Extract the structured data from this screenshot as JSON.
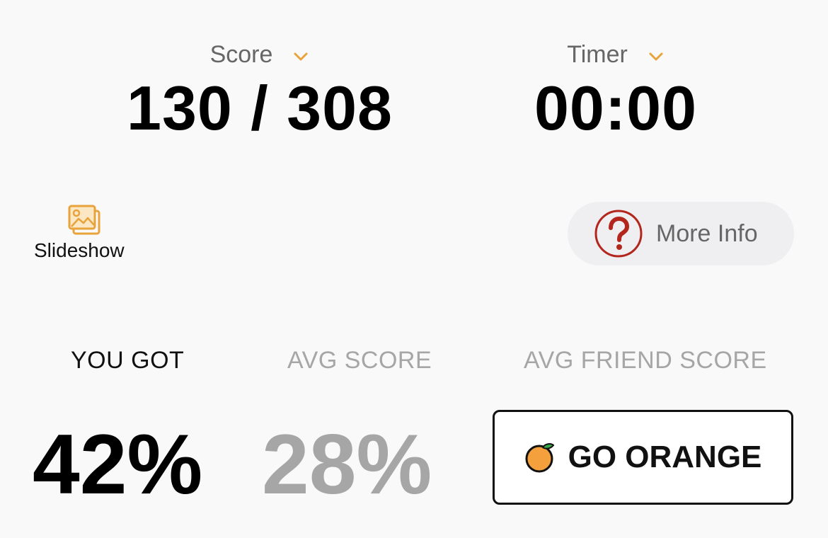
{
  "score": {
    "label": "Score",
    "value": "130 / 308"
  },
  "timer": {
    "label": "Timer",
    "value": "00:00"
  },
  "slideshow": {
    "label": "Slideshow"
  },
  "more_info": {
    "label": "More Info"
  },
  "results": {
    "you_got_label": "YOU GOT",
    "you_got_value": "42%",
    "avg_score_label": "AVG SCORE",
    "avg_score_value": "28%",
    "avg_friend_label": "AVG FRIEND SCORE",
    "go_orange_label": "GO ORANGE"
  },
  "colors": {
    "accent": "#e8a33a",
    "help_red": "#b3261e",
    "muted": "#666666",
    "faded": "#a6a6a6"
  },
  "icons": {
    "score_dropdown": "chevron-down-icon",
    "timer_dropdown": "chevron-down-icon",
    "slideshow": "image-stack-icon",
    "more_info": "question-circle-icon",
    "go_orange": "orange-fruit-icon"
  }
}
